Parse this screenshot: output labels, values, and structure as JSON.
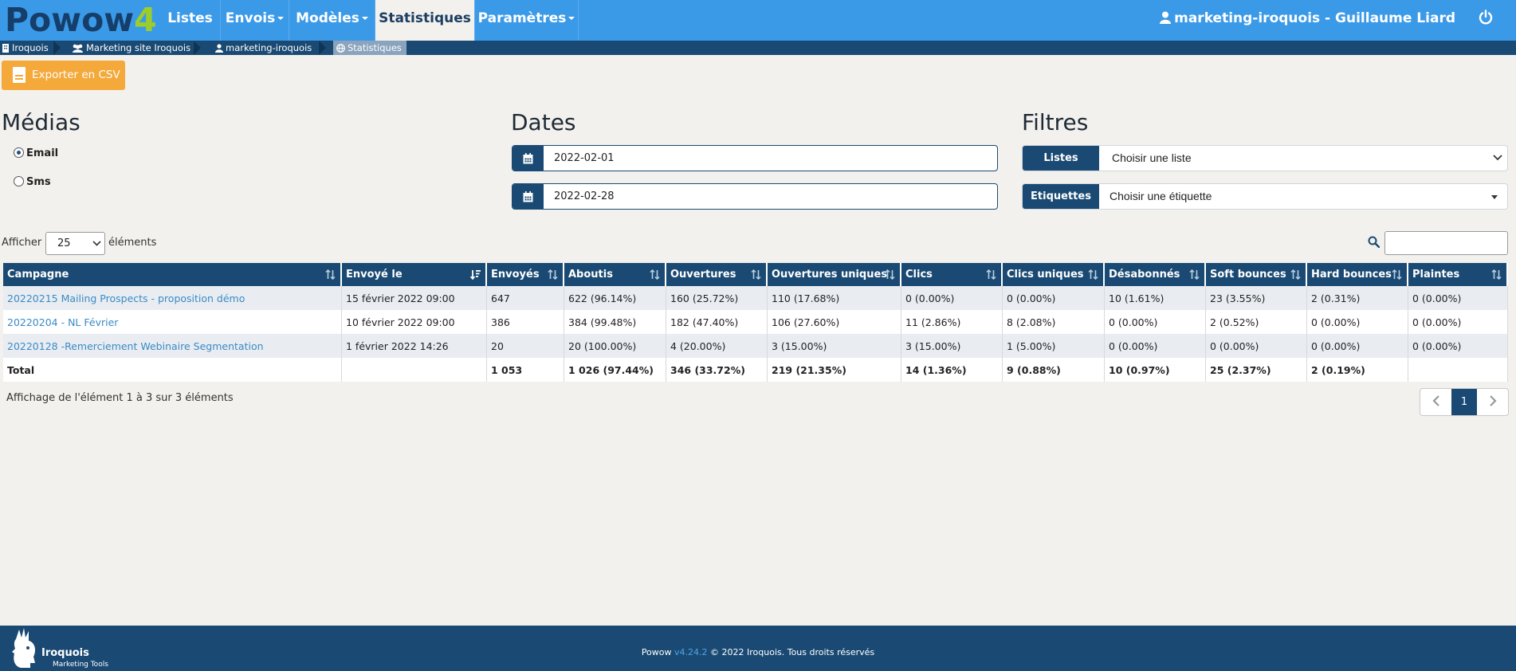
{
  "logo": {
    "part1": "Powow",
    "part2": "4"
  },
  "nav": {
    "items": [
      {
        "label": "Listes",
        "dropdown": false
      },
      {
        "label": "Envois",
        "dropdown": true
      },
      {
        "label": "Modèles",
        "dropdown": true
      },
      {
        "label": "Statistiques",
        "dropdown": false,
        "active": true
      },
      {
        "label": "Paramètres",
        "dropdown": true
      }
    ],
    "user": "marketing-iroquois - Guillaume Liard"
  },
  "breadcrumb": [
    "Iroquois",
    "Marketing site Iroquois",
    "marketing-iroquois",
    "Statistiques"
  ],
  "export_label": "Exporter en CSV",
  "medias": {
    "title": "Médias",
    "options": [
      {
        "label": "Email",
        "checked": true
      },
      {
        "label": "Sms",
        "checked": false
      }
    ]
  },
  "dates": {
    "title": "Dates",
    "start": "2022-02-01",
    "end": "2022-02-28"
  },
  "filtres": {
    "title": "Filtres",
    "listes_label": "Listes",
    "listes_value": "Choisir une liste",
    "etiquettes_label": "Etiquettes",
    "etiquettes_value": "Choisir une étiquette"
  },
  "table_controls": {
    "show_label": "Afficher",
    "page_size": "25",
    "elements_label": "éléments"
  },
  "table": {
    "headers": [
      "Campagne",
      "Envoyé le",
      "Envoyés",
      "Aboutis",
      "Ouvertures",
      "Ouvertures uniques",
      "Clics",
      "Clics uniques",
      "Désabonnés",
      "Soft bounces",
      "Hard bounces",
      "Plaintes"
    ],
    "rows": [
      [
        "20220215 Mailing Prospects - proposition démo",
        "15 février 2022 09:00",
        "647",
        "622 (96.14%)",
        "160 (25.72%)",
        "110 (17.68%)",
        "0 (0.00%)",
        "0 (0.00%)",
        "10 (1.61%)",
        "23 (3.55%)",
        "2 (0.31%)",
        "0 (0.00%)"
      ],
      [
        "20220204 - NL Février",
        "10 février 2022 09:00",
        "386",
        "384 (99.48%)",
        "182 (47.40%)",
        "106 (27.60%)",
        "11 (2.86%)",
        "8 (2.08%)",
        "0 (0.00%)",
        "2 (0.52%)",
        "0 (0.00%)",
        "0 (0.00%)"
      ],
      [
        "20220128 -Remerciement Webinaire Segmentation",
        "1 février 2022 14:26",
        "20",
        "20 (100.00%)",
        "4 (20.00%)",
        "3 (15.00%)",
        "3 (15.00%)",
        "1 (5.00%)",
        "0 (0.00%)",
        "0 (0.00%)",
        "0 (0.00%)",
        "0 (0.00%)"
      ]
    ],
    "total": [
      "Total",
      "",
      "1 053",
      "1 026 (97.44%)",
      "346 (33.72%)",
      "219 (21.35%)",
      "14 (1.36%)",
      "9 (0.88%)",
      "10 (0.97%)",
      "25 (2.37%)",
      "2 (0.19%)",
      ""
    ]
  },
  "table_info": "Affichage de l'élément 1 à 3 sur 3 éléments",
  "pagination": {
    "current": "1"
  },
  "footer": {
    "prefix": "Powow ",
    "version": "v4.24.2",
    "suffix": " © 2022 Iroquois. Tous droits réservés",
    "brand": "Iroquois",
    "brand_sub": "Marketing Tools"
  },
  "colors": {
    "nav_bg": "#3b9ae8",
    "dark_blue": "#1a4a73",
    "export_orange": "#f4a93a",
    "link": "#3a8ac6"
  }
}
